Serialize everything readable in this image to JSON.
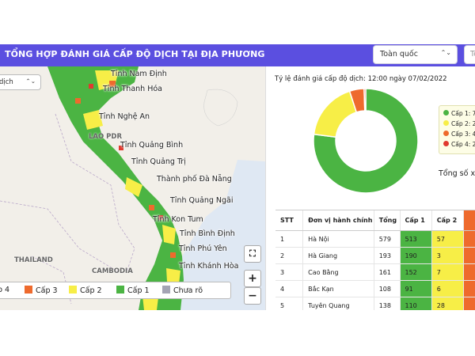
{
  "header": {
    "title": "TỔNG HỢP ĐÁNH GIÁ CẤP ĐỘ DỊCH TẠI ĐỊA PHƯƠNG",
    "region_value": "Toàn quốc",
    "date_placeholder": "To"
  },
  "colors": {
    "header_bg": "#5b4fe0",
    "level1": "#4bb443",
    "level2": "#f7ee47",
    "level3": "#ee6a2d",
    "level4": "#e03a2f",
    "unknown": "#a4a4b4"
  },
  "map": {
    "layer_select_value": "dịch",
    "places": [
      "Tỉnh Nam Định",
      "Tỉnh Thanh Hóa",
      "Tỉnh Nghệ An",
      "Tỉnh Quảng Bình",
      "Tỉnh Quảng Trị",
      "Thành phố Đà Nẵng",
      "Tỉnh Quảng Ngãi",
      "Tỉnh Kon Tum",
      "Tỉnh Bình Định",
      "Tỉnh Phú Yên",
      "Tỉnh Khánh Hòa"
    ],
    "countries": [
      "LAO PDR",
      "THAILAND",
      "CAMBODIA"
    ],
    "legend": [
      {
        "label": "p 4",
        "color": "#e03a2f"
      },
      {
        "label": "Cấp 3",
        "color": "#ee6a2d"
      },
      {
        "label": "Cấp 2",
        "color": "#f7ee47"
      },
      {
        "label": "Cấp 1",
        "color": "#4bb443"
      },
      {
        "label": "Chưa rõ",
        "color": "#a4a4b4"
      }
    ],
    "zoom_in": "+",
    "zoom_out": "−",
    "fullscreen_icon": "fullscreen-icon"
  },
  "panel": {
    "chart_caption": "Tỷ lệ đánh giá cấp độ dịch: 12:00 ngày 07/02/2022",
    "total_label": "Tổng số xã:",
    "chart_legend": [
      "Cấp 1: 7",
      "Cấp 2: 2",
      "Cấp 3: 4",
      "Cấp 4: 2"
    ]
  },
  "chart_data": {
    "type": "pie",
    "categories": [
      "Cấp 1",
      "Cấp 2",
      "Cấp 3",
      "Cấp 4"
    ],
    "values": [
      77,
      18,
      4.5,
      0.5
    ],
    "colors": [
      "#4bb443",
      "#f7ee47",
      "#ee6a2d",
      "#e03a2f"
    ],
    "donut": true
  },
  "table": {
    "headers": [
      "STT",
      "Đơn vị hành chính",
      "Tổng",
      "Cấp 1",
      "Cấp 2",
      ""
    ],
    "rows": [
      [
        "1",
        "Hà Nội",
        "579",
        "513",
        "57"
      ],
      [
        "2",
        "Hà Giang",
        "193",
        "190",
        "3"
      ],
      [
        "3",
        "Cao Bằng",
        "161",
        "152",
        "7"
      ],
      [
        "4",
        "Bắc Kạn",
        "108",
        "91",
        "6"
      ],
      [
        "5",
        "Tuyên Quang",
        "138",
        "110",
        "28"
      ]
    ]
  }
}
